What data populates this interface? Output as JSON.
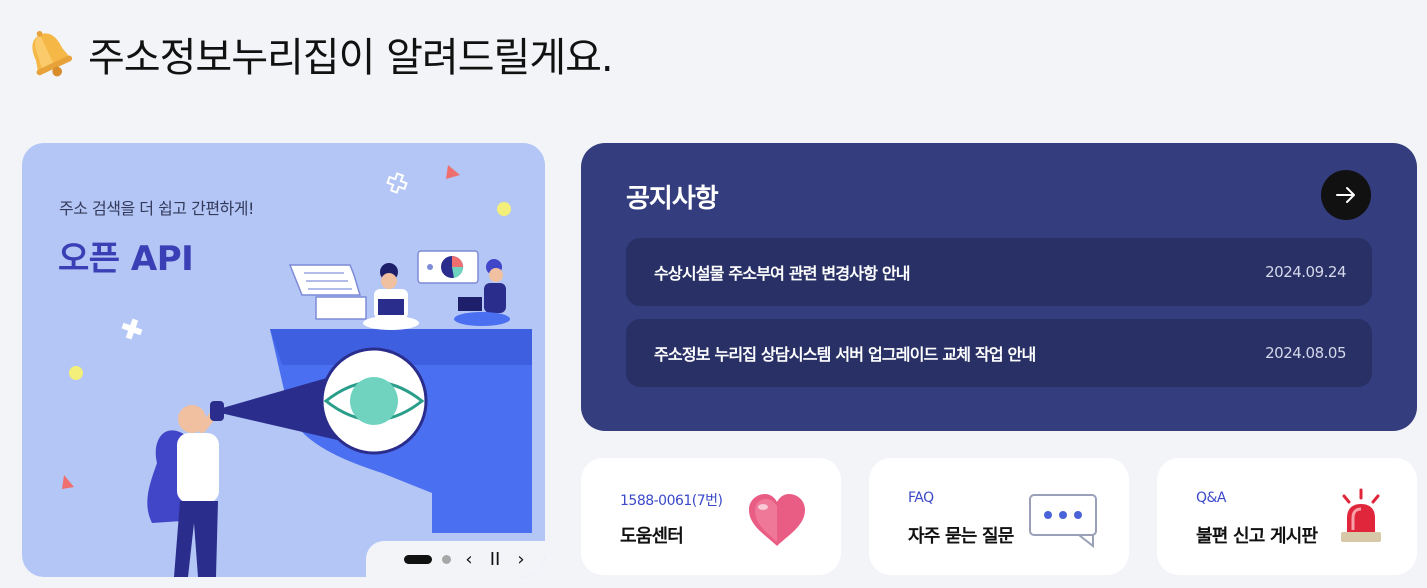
{
  "section": {
    "title": "주소정보누리집이 알려드릴게요."
  },
  "banner": {
    "subtitle": "주소 검색을 더 쉽고 간편하게!",
    "title": "오픈 API",
    "controls": {
      "prev": "‹",
      "pause": "II",
      "next": "›"
    }
  },
  "notice": {
    "title": "공지사항",
    "items": [
      {
        "title": "수상시설물 주소부여 관련 변경사항 안내",
        "date": "2024.09.24"
      },
      {
        "title": "주소정보 누리집 상담시스템 서버 업그레이드 교체 작업 안내",
        "date": "2024.08.05"
      }
    ]
  },
  "cards": [
    {
      "small": "1588-0061(7번)",
      "label": "도움센터",
      "icon": "heart-icon"
    },
    {
      "small": "FAQ",
      "label": "자주 묻는 질문",
      "icon": "speech-bubble-icon"
    },
    {
      "small": "Q&A",
      "label": "불편 신고 게시판",
      "icon": "siren-icon"
    }
  ],
  "colors": {
    "background": "#f3f4f8",
    "banner_bg": "#b4c6f5",
    "notice_bg": "#343d7e",
    "notice_row_bg": "#283065",
    "accent_blue": "#3b49c9"
  }
}
